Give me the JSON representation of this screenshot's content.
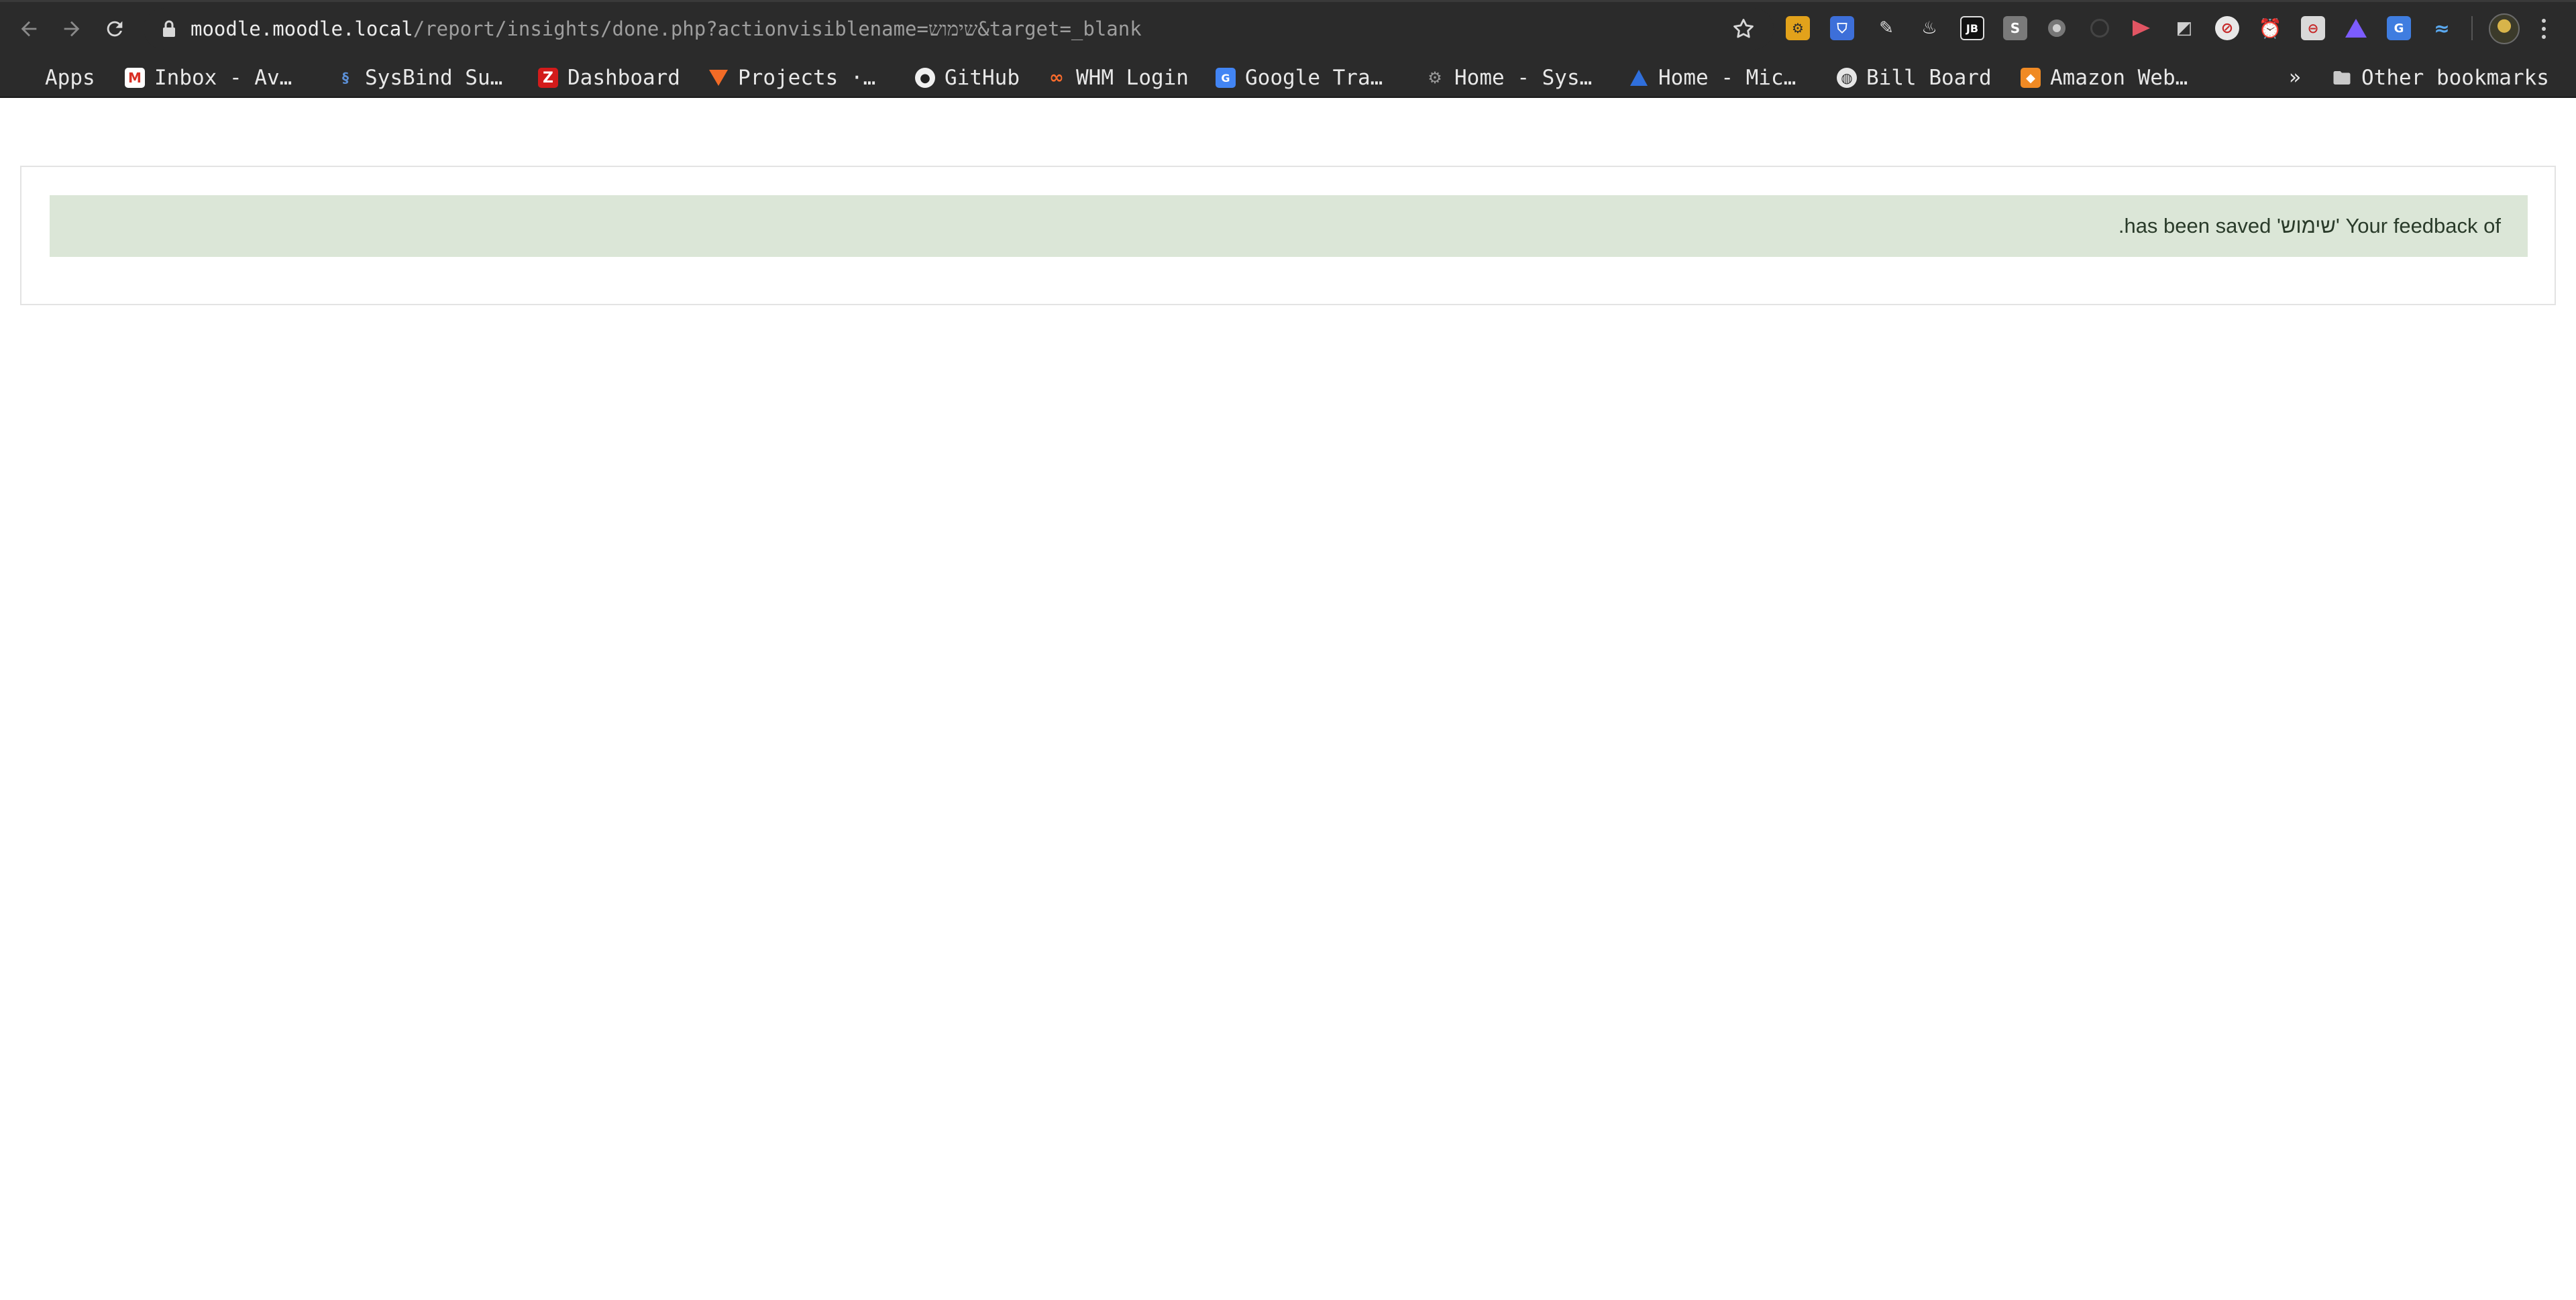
{
  "browser": {
    "url_host": "moodle.moodle.local",
    "url_path": "/report/insights/done.php?actionvisiblename=שימוש&target=_blank",
    "extension_icons": [
      "settings-gear-extension-icon",
      "bitwarden-extension-icon",
      "pencil-extension-icon",
      "fire-extension-icon",
      "jetbrains-extension-icon",
      "s-extension-icon",
      "circle-extension-icon",
      "dark-circle-extension-icon",
      "arrow-extension-icon",
      "cube-extension-icon",
      "globe-blocked-extension-icon",
      "clock-extension-icon",
      "calendar-blocked-extension-icon",
      "mountain-extension-icon",
      "translate-extension-icon",
      "wave-extension-icon"
    ],
    "menu_icon": "kebab-menu-icon"
  },
  "bookmarks": {
    "items": [
      {
        "label": "Apps",
        "icon": "apps-grid-icon"
      },
      {
        "label": "Inbox - Av…",
        "icon": "gmail-icon"
      },
      {
        "label": "SysBind Su…",
        "icon": "sysbind-icon"
      },
      {
        "label": "Dashboard",
        "icon": "zendesk-z-icon"
      },
      {
        "label": "Projects ·…",
        "icon": "gitlab-icon"
      },
      {
        "label": "GitHub",
        "icon": "github-icon"
      },
      {
        "label": "WHM Login",
        "icon": "cpanel-icon"
      },
      {
        "label": "Google Tra…",
        "icon": "google-translate-icon"
      },
      {
        "label": "Home - Sys…",
        "icon": "gear-icon"
      },
      {
        "label": "Home - Mic…",
        "icon": "atlassian-icon"
      },
      {
        "label": "Bill Board",
        "icon": "globe-icon"
      },
      {
        "label": "Amazon Web…",
        "icon": "aws-cube-icon"
      }
    ],
    "overflow_label": "»",
    "other_label": "Other bookmarks"
  },
  "page": {
    "notice": "Your feedback of 'שימוש' has been saved.",
    "notice_color": "#dbe6d7"
  }
}
